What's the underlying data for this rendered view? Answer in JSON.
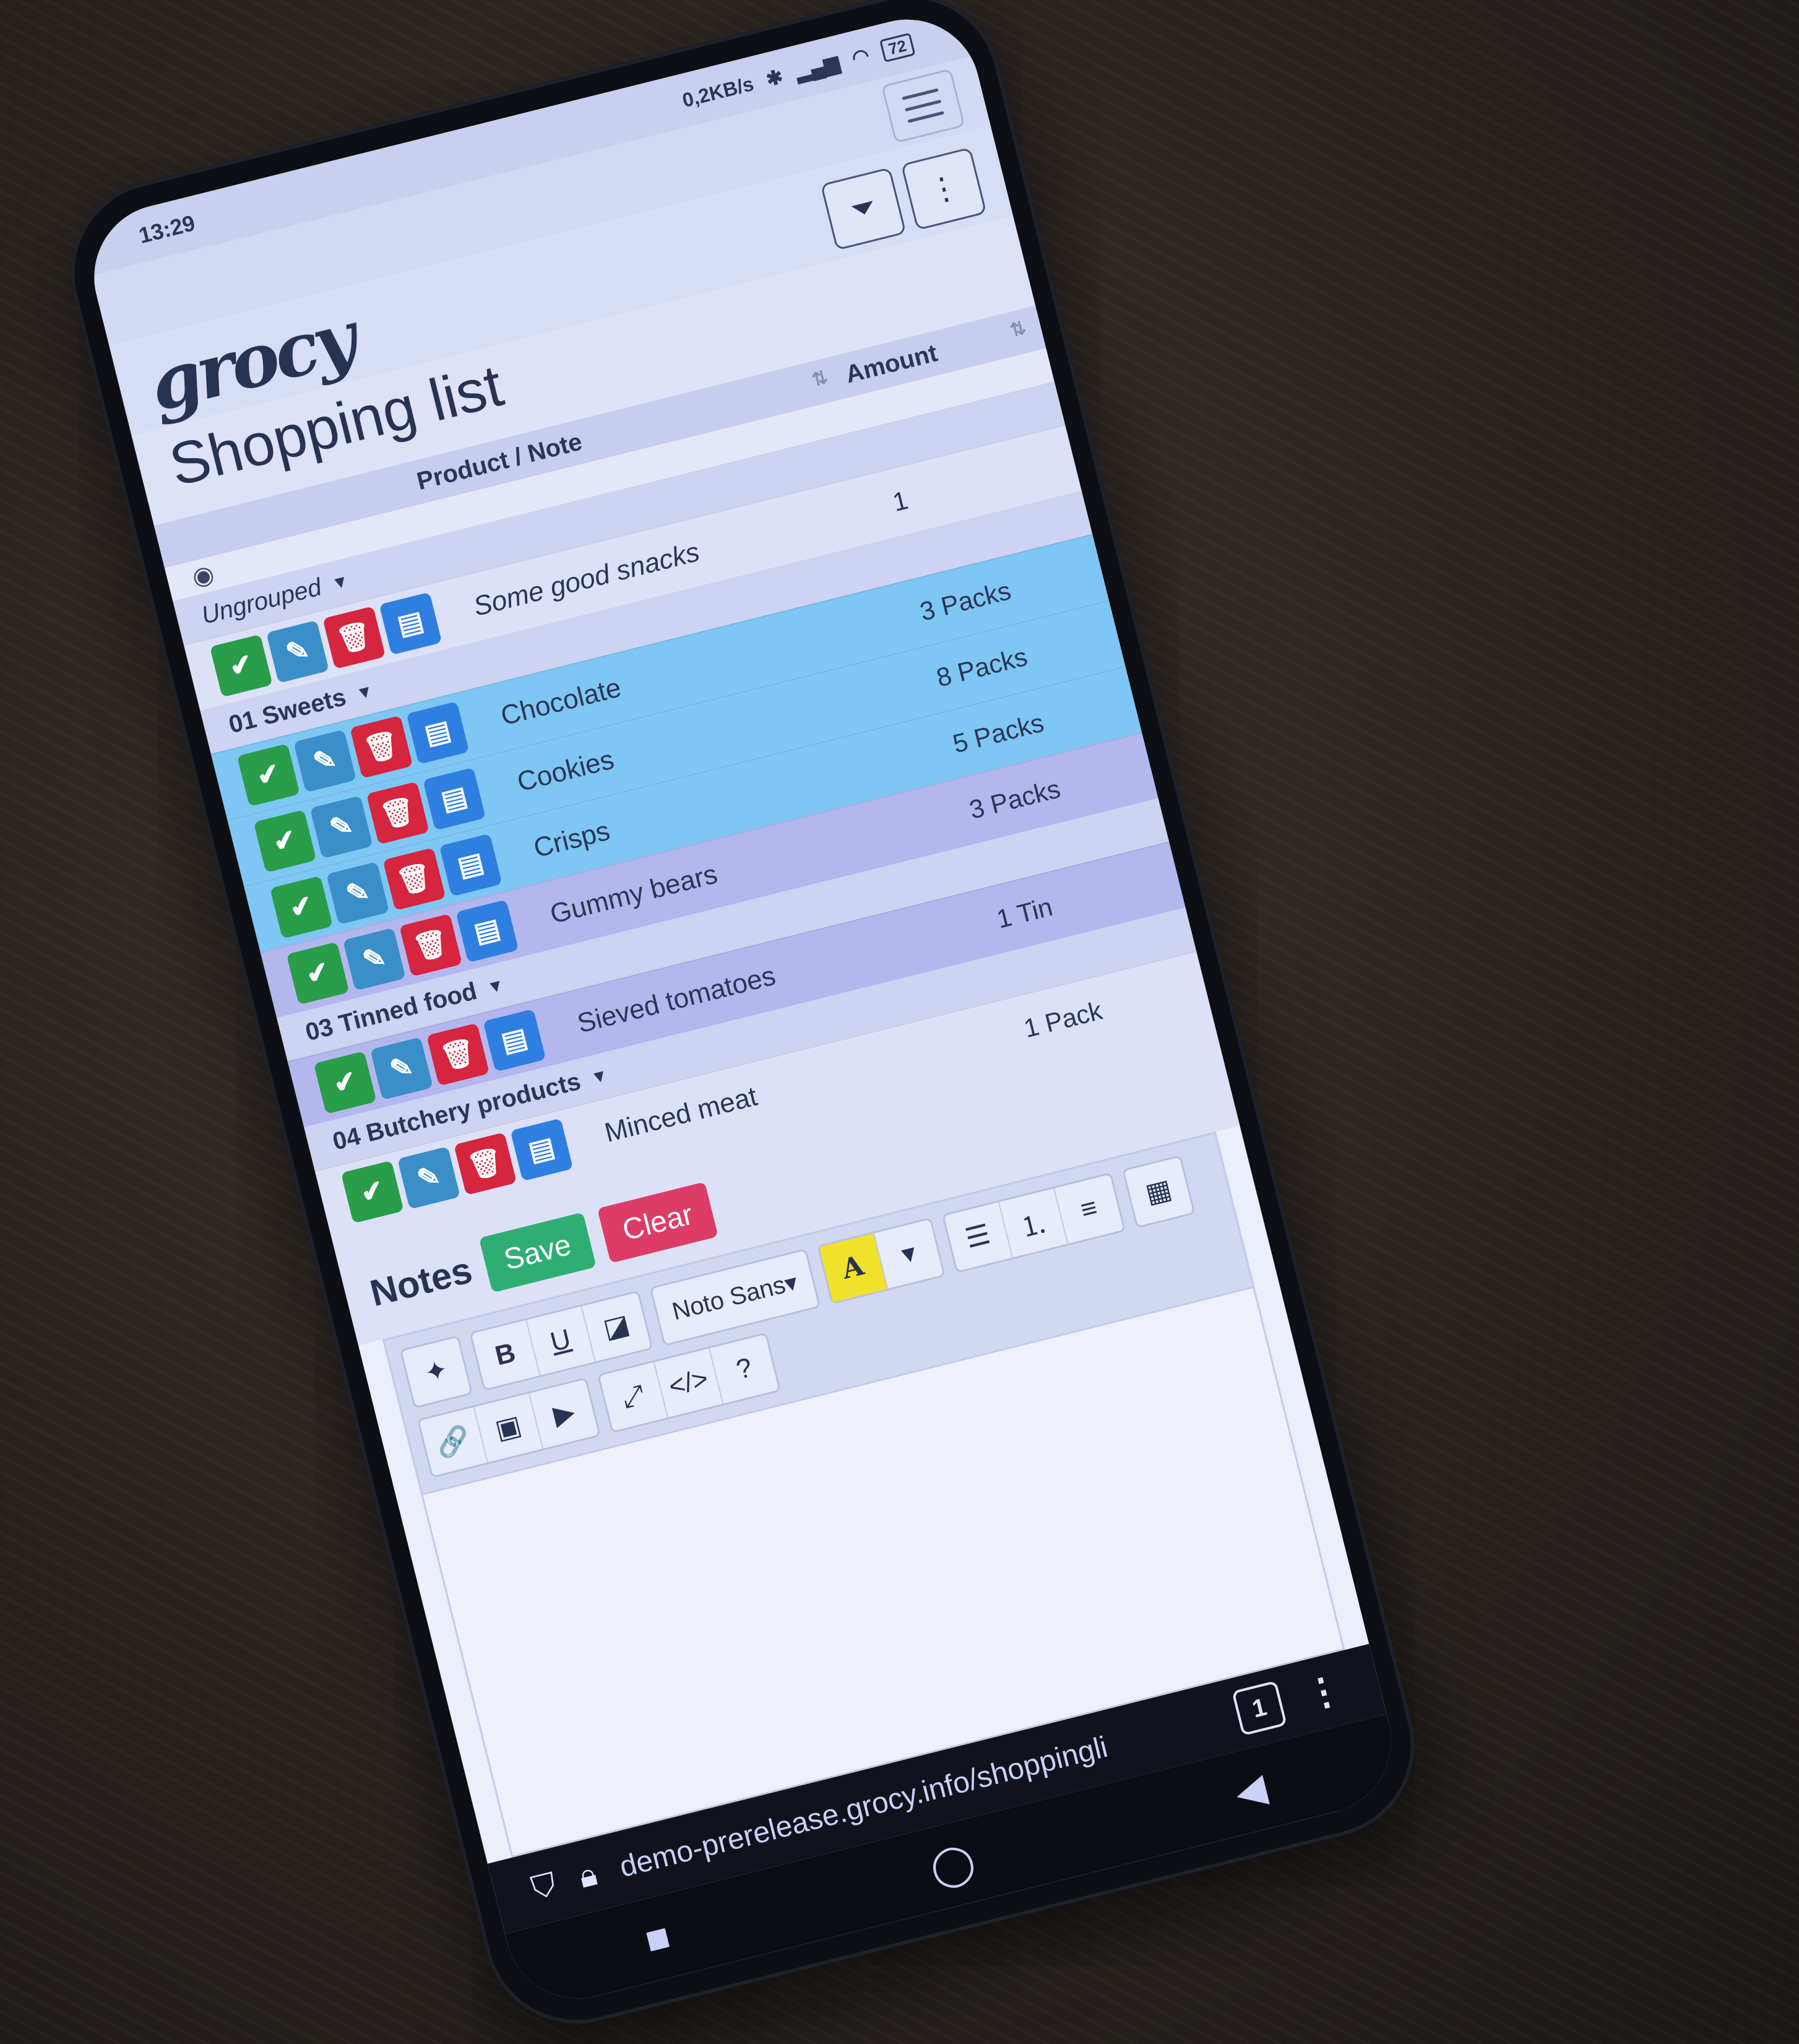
{
  "status": {
    "time": "13:29",
    "speed": "0,2KB/s",
    "battery": "72"
  },
  "app": {
    "logo": "grocy",
    "page_title": "Shopping list"
  },
  "table": {
    "col_product": "Product / Note",
    "col_amount": "Amount",
    "groups": [
      {
        "name": "Ungrouped",
        "italic": true,
        "items": [
          {
            "name": "Some good snacks",
            "amount": "1",
            "style": "pale",
            "note": true
          }
        ]
      },
      {
        "name": "01 Sweets",
        "items": [
          {
            "name": "Chocolate",
            "amount": "3 Packs",
            "style": "blue"
          },
          {
            "name": "Cookies",
            "amount": "8 Packs",
            "style": "blue"
          },
          {
            "name": "Crisps",
            "amount": "5 Packs",
            "style": "blue"
          },
          {
            "name": "Gummy bears",
            "amount": "3 Packs",
            "style": "lav"
          }
        ]
      },
      {
        "name": "03 Tinned food",
        "items": [
          {
            "name": "Sieved tomatoes",
            "amount": "1 Tin",
            "style": "lav"
          }
        ]
      },
      {
        "name": "04 Butchery products",
        "items": [
          {
            "name": "Minced meat",
            "amount": "1 Pack",
            "style": "pale"
          }
        ]
      }
    ]
  },
  "notes": {
    "title": "Notes",
    "save_label": "Save",
    "clear_label": "Clear",
    "font_name": "Noto Sans",
    "highlight_letter": "A",
    "bold": "B",
    "underline": "U",
    "help": "?",
    "code": "</>"
  },
  "browser": {
    "url": "demo-prerelease.grocy.info/shoppingli",
    "tab_count": "1"
  },
  "colors": {
    "done": "#2a9d4a",
    "edit": "#3a8fc8",
    "delete": "#d5253f",
    "stock": "#2f7fe0",
    "save": "#2fae74",
    "clear": "#dd3c68"
  }
}
